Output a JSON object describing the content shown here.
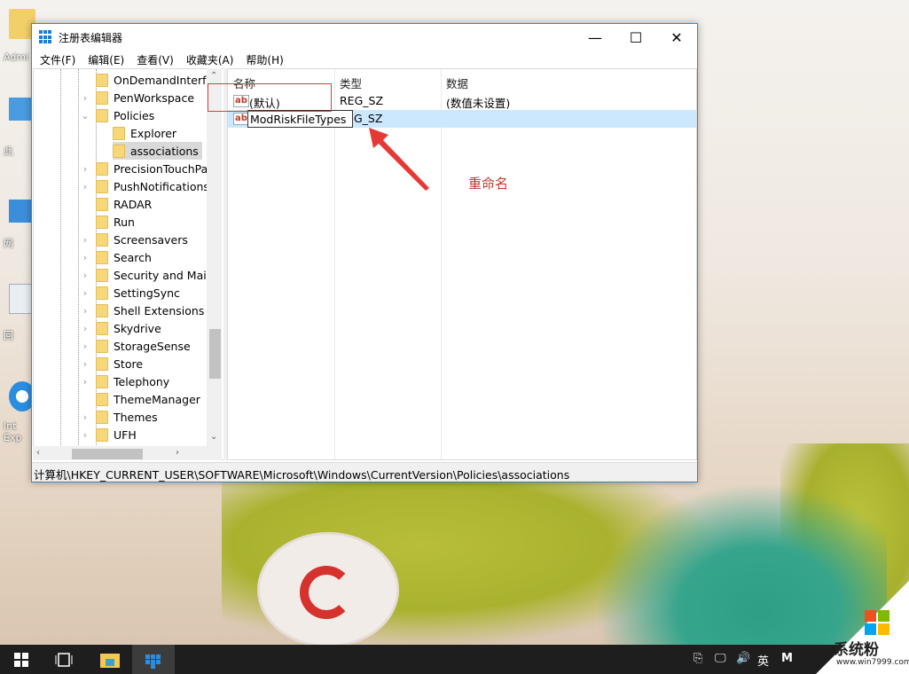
{
  "desktop": {
    "icons": [
      {
        "label": "Admi",
        "icon": "user-folder-icon"
      },
      {
        "label": "此",
        "icon": "this-pc-icon"
      },
      {
        "label": "网",
        "icon": "network-icon"
      },
      {
        "label": "回",
        "icon": "recycle-bin-icon"
      },
      {
        "label": "Int Exp",
        "icon": "internet-explorer-icon"
      }
    ]
  },
  "window": {
    "title": "注册表编辑器",
    "controls": {
      "minimize": "—",
      "maximize": "☐",
      "close": "✕"
    },
    "menu": [
      "文件(F)",
      "编辑(E)",
      "查看(V)",
      "收藏夹(A)",
      "帮助(H)"
    ]
  },
  "tree": {
    "items": [
      {
        "label": "OnDemandInterfa",
        "expander": "",
        "level": 0
      },
      {
        "label": "PenWorkspace",
        "expander": "›",
        "level": 0
      },
      {
        "label": "Policies",
        "expander": "⌄",
        "level": 0
      },
      {
        "label": "Explorer",
        "expander": "",
        "level": 1
      },
      {
        "label": "associations",
        "expander": "",
        "level": 1,
        "selected": true
      },
      {
        "label": "PrecisionTouchPac",
        "expander": "›",
        "level": 0
      },
      {
        "label": "PushNotifications",
        "expander": "›",
        "level": 0
      },
      {
        "label": "RADAR",
        "expander": "",
        "level": 0
      },
      {
        "label": "Run",
        "expander": "",
        "level": 0
      },
      {
        "label": "Screensavers",
        "expander": "›",
        "level": 0
      },
      {
        "label": "Search",
        "expander": "›",
        "level": 0
      },
      {
        "label": "Security and Maint",
        "expander": "›",
        "level": 0
      },
      {
        "label": "SettingSync",
        "expander": "›",
        "level": 0
      },
      {
        "label": "Shell Extensions",
        "expander": "›",
        "level": 0
      },
      {
        "label": "Skydrive",
        "expander": "›",
        "level": 0
      },
      {
        "label": "StorageSense",
        "expander": "›",
        "level": 0
      },
      {
        "label": "Store",
        "expander": "›",
        "level": 0
      },
      {
        "label": "Telephony",
        "expander": "›",
        "level": 0
      },
      {
        "label": "ThemeManager",
        "expander": "",
        "level": 0
      },
      {
        "label": "Themes",
        "expander": "›",
        "level": 0
      },
      {
        "label": "UFH",
        "expander": "›",
        "level": 0
      }
    ]
  },
  "list": {
    "columns": [
      "名称",
      "类型",
      "数据"
    ],
    "rows": [
      {
        "name": "(默认)",
        "type": "REG_SZ",
        "data": "(数值未设置)"
      },
      {
        "name": "ModRiskFileTypes",
        "type": "G_SZ",
        "data": "",
        "editing": true
      }
    ]
  },
  "status_path": "计算机\\HKEY_CURRENT_USER\\SOFTWARE\\Microsoft\\Windows\\CurrentVersion\\Policies\\associations",
  "annotation": {
    "text": "重命名",
    "color": "#c0392b"
  },
  "taskbar": {
    "tray": {
      "usb": "⎘",
      "network": "🖵",
      "volume": "🔊",
      "ime": "英",
      "m": "M"
    }
  },
  "watermark": {
    "brand": "系统粉",
    "url": "www.win7999.com",
    "colors": [
      "#f25022",
      "#7fba00",
      "#00a4ef",
      "#ffb900"
    ]
  }
}
